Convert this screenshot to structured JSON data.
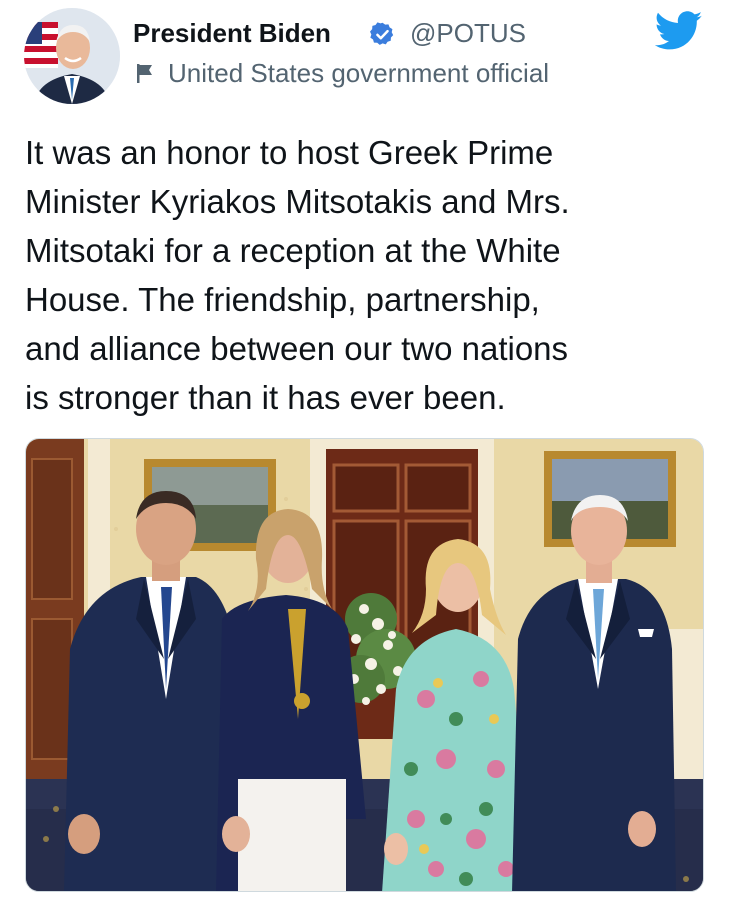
{
  "author": {
    "name": "President Biden",
    "handle": "@POTUS",
    "label": "United States government official",
    "avatar_icon": "avatar-portrait",
    "verified_icon": "verified-badge-icon",
    "label_icon": "flag-icon"
  },
  "app": {
    "logo_icon": "twitter-bird-icon",
    "accent_color": "#1d9bf0"
  },
  "tweet": {
    "text_lines": [
      "It was an honor to host Greek Prime",
      "Minister Kyriakos Mitsotakis and Mrs.",
      "Mitsotaki for a reception at the White",
      "House. The friendship, partnership,",
      "and alliance between our two nations",
      "is stronger than it has ever been."
    ]
  },
  "media": {
    "type": "photo"
  }
}
